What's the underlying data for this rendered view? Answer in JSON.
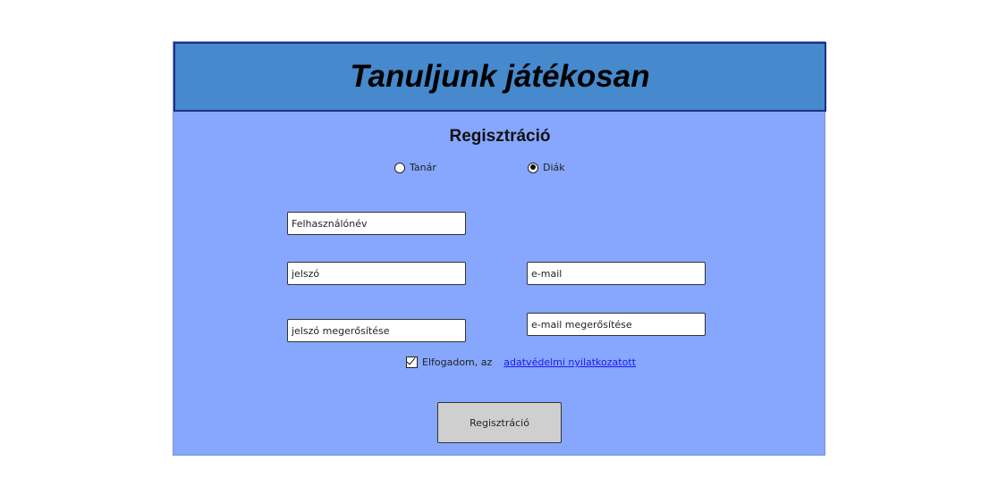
{
  "header": {
    "title": "Tanuljunk játékosan"
  },
  "form": {
    "title": "Regisztráció",
    "role_options": [
      {
        "label": "Tanár",
        "selected": false
      },
      {
        "label": "Diák",
        "selected": true
      }
    ],
    "fields": {
      "username_placeholder": "Felhasználónév",
      "password_placeholder": "jelszó",
      "password_confirm_placeholder": "jelszó megerősítése",
      "email_placeholder": "e-mail",
      "email_confirm_placeholder": "e-mail megerősítése"
    },
    "consent": {
      "checked": true,
      "text": "Elfogadom, az",
      "link_text": "adatvédelmi nyilatkozatott"
    },
    "submit_label": "Regisztráció"
  },
  "colors": {
    "header_bg": "#4689cc",
    "header_border": "#1d2f8a",
    "body_bg": "#87a6fd",
    "button_bg": "#cfcfcf",
    "link": "#1a1aee"
  }
}
